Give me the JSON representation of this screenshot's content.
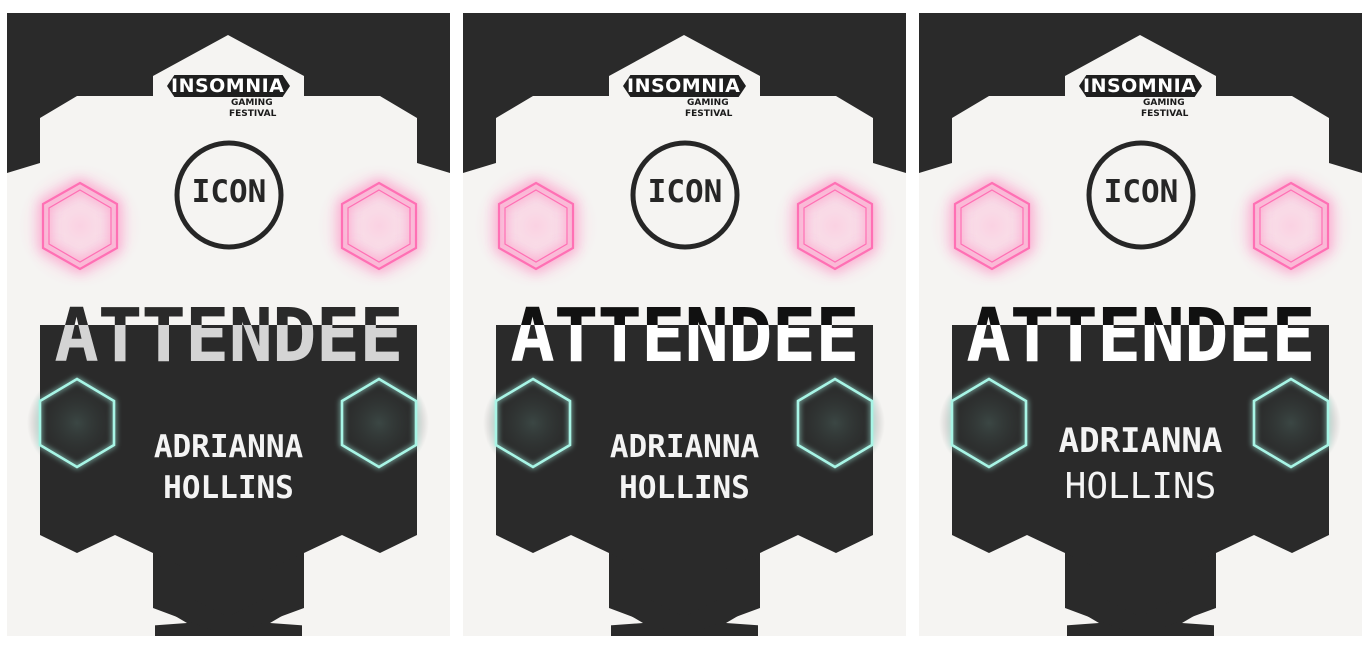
{
  "colors": {
    "dark": "#2a2a2a",
    "light": "#f5f4f2",
    "pink_glow": "#ff5aa8",
    "teal_glow": "#9ff2e4"
  },
  "badges": [
    {
      "logo": {
        "main": "INSOMNIA",
        "sub_line1": "GAMING",
        "sub_line2": "FESTIVAL"
      },
      "icon_label": "ICON",
      "role": "ATTENDEE",
      "role_color_top": "#2a2a2a",
      "role_color_bottom": "#d4d4d4",
      "first_name": "ADRIANNA",
      "last_name": "HOLLINS",
      "last_name_weight": "bold"
    },
    {
      "logo": {
        "main": "INSOMNIA",
        "sub_line1": "GAMING",
        "sub_line2": "FESTIVAL"
      },
      "icon_label": "ICON",
      "role": "ATTENDEE",
      "role_color_top": "#111111",
      "role_color_bottom": "#ffffff",
      "first_name": "ADRIANNA",
      "last_name": "HOLLINS",
      "last_name_weight": "bold"
    },
    {
      "logo": {
        "main": "INSOMNIA",
        "sub_line1": "GAMING",
        "sub_line2": "FESTIVAL"
      },
      "icon_label": "ICON",
      "role": "ATTENDEE",
      "role_color_top": "#111111",
      "role_color_bottom": "#ffffff",
      "first_name": "ADRIANNA",
      "last_name": "HOLLINS",
      "last_name_weight": "normal"
    }
  ]
}
